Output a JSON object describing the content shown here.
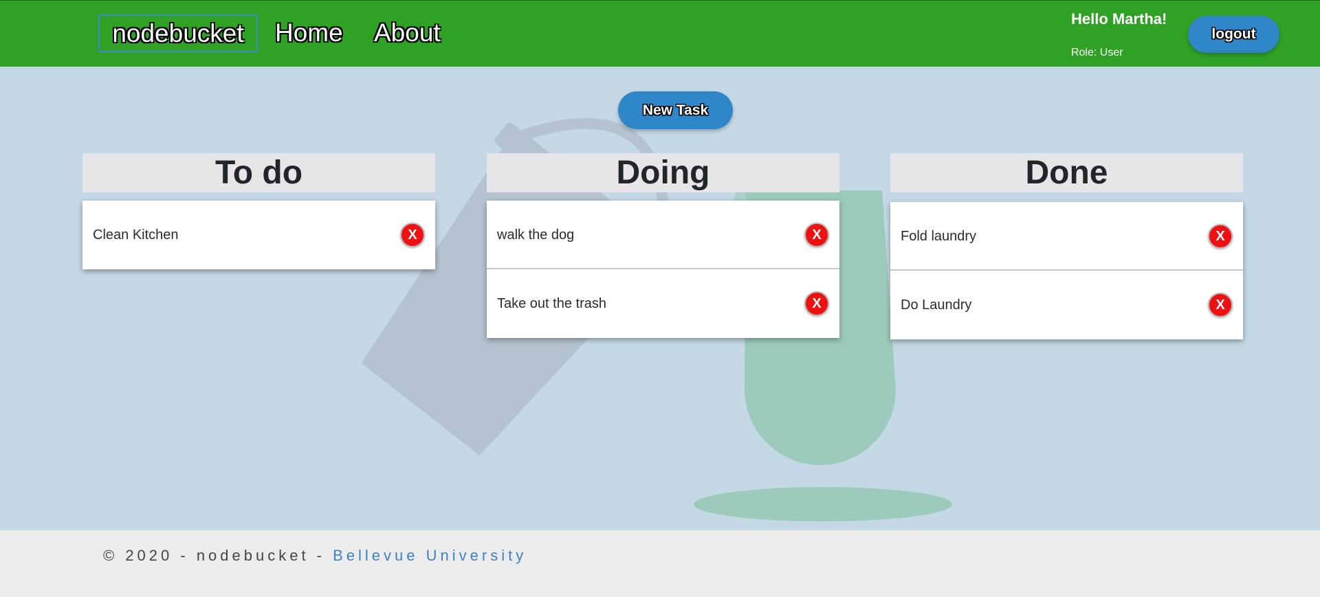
{
  "header": {
    "brand": "nodebucket",
    "nav": {
      "home": "Home",
      "about": "About"
    },
    "greeting": "Hello Martha!",
    "role": "Role: User",
    "logout_label": "logout"
  },
  "actions": {
    "new_task_label": "New Task"
  },
  "columns": [
    {
      "title": "To do",
      "tasks": [
        "Clean Kitchen"
      ]
    },
    {
      "title": "Doing",
      "tasks": [
        "walk the dog",
        "Take out the trash"
      ]
    },
    {
      "title": "Done",
      "tasks": [
        "Fold laundry",
        "Do Laundry"
      ]
    }
  ],
  "delete_label": "X",
  "footer": {
    "text": "© 2020 - nodebucket - ",
    "link": "Bellevue University"
  },
  "colors": {
    "header_bg": "#2fa225",
    "page_bg": "#c5d8e6",
    "button_bg": "#2f86c9",
    "delete_bg": "#ee1111",
    "link": "#3b82c4"
  },
  "icons": {
    "background": "bucket-icon",
    "delete": "delete-icon"
  }
}
